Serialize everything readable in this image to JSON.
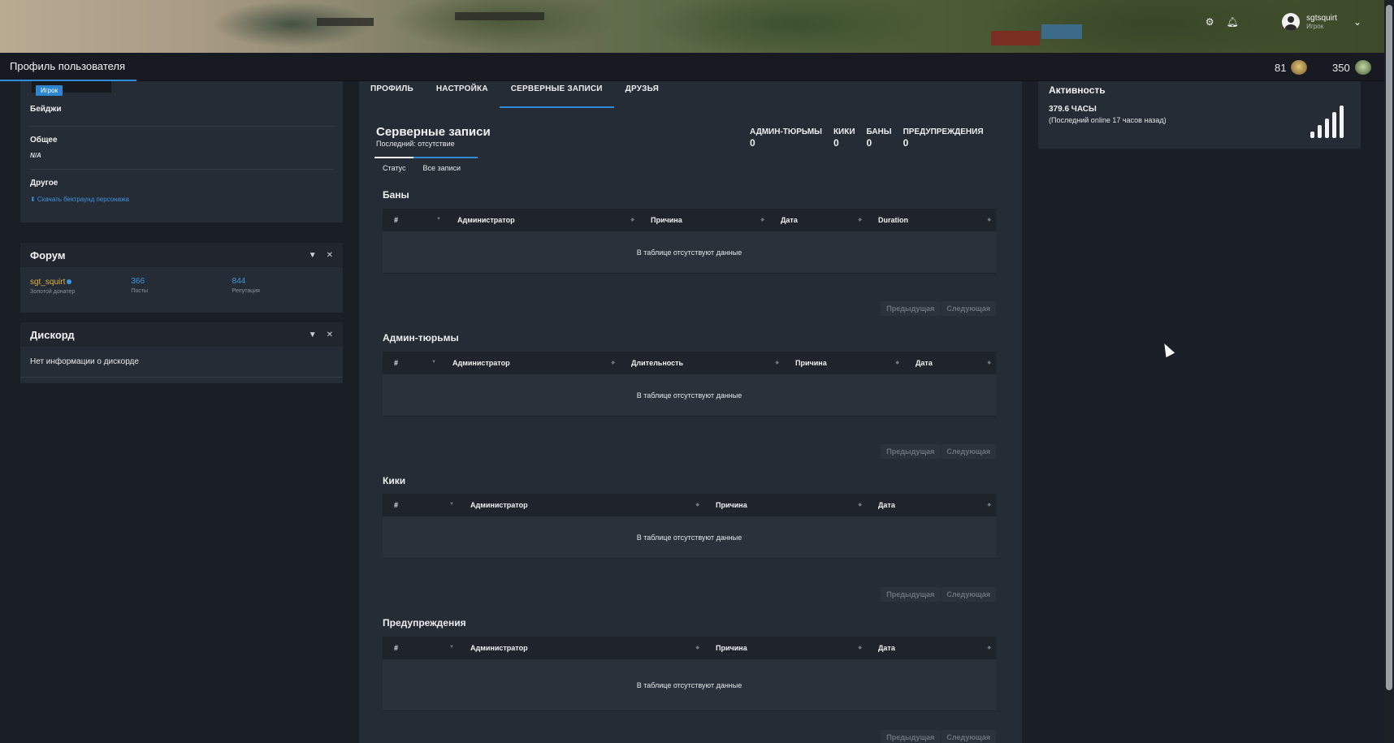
{
  "header": {
    "user_name": "sgtsquirt",
    "user_sub": "Игрок"
  },
  "topbar": {
    "title": "Профиль пользователя",
    "medals": "81",
    "coins": "350"
  },
  "profile": {
    "role_badge": "Игрок",
    "badges_label": "Бейджи",
    "general_label": "Общее",
    "general_value": "N/A",
    "other_label": "Другое",
    "download_link": "⬇ Скачать бектраунд персонажа"
  },
  "forum": {
    "title": "Форум",
    "username": "sgt_squirt",
    "user_rank": "Золотой донатер",
    "posts": "366",
    "posts_label": "Посты",
    "reputation": "844",
    "reputation_label": "Репутация"
  },
  "discord": {
    "title": "Дискорд",
    "text": "Нет информации о дискорде"
  },
  "tabs": [
    "ПРОФИЛЬ",
    "НАСТРОЙКА",
    "СЕРВЕРНЫЕ ЗАПИСИ",
    "ДРУЗЬЯ"
  ],
  "records": {
    "title": "Серверные записи",
    "subtitle": "Последний: отсутствие",
    "counters": [
      {
        "label": "АДМИН-ТЮРЬМЫ",
        "value": "0"
      },
      {
        "label": "КИКИ",
        "value": "0"
      },
      {
        "label": "БАНЫ",
        "value": "0"
      },
      {
        "label": "ПРЕДУПРЕЖДЕНИЯ",
        "value": "0"
      }
    ],
    "subtabs": [
      "Статус",
      "Все записи"
    ],
    "empty_text": "В таблице отсутствуют данные",
    "prev": "Предыдущая",
    "next": "Следующая",
    "bans": {
      "title": "Баны",
      "cols": [
        "#",
        "Администратор",
        "Причина",
        "Дата",
        "Duration"
      ]
    },
    "jails": {
      "title": "Админ-тюрьмы",
      "cols": [
        "#",
        "Администратор",
        "Длительность",
        "Причина",
        "Дата"
      ]
    },
    "kicks": {
      "title": "Кики",
      "cols": [
        "#",
        "Администратор",
        "Причина",
        "Дата"
      ]
    },
    "warnings": {
      "title": "Предупреждения",
      "cols": [
        "#",
        "Администратор",
        "Причина",
        "Дата"
      ]
    }
  },
  "activity": {
    "title": "Активность",
    "hours": "379.6 ЧАСЫ",
    "last_online": "(Последний online 17 часов назад)"
  }
}
